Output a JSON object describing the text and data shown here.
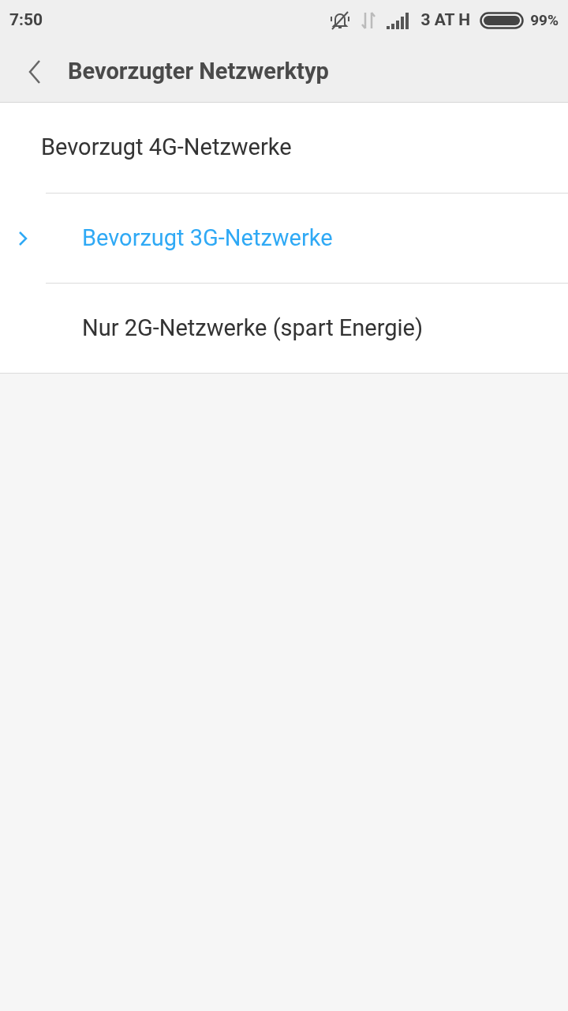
{
  "status_bar": {
    "time": "7:50",
    "carrier": "3 AT H",
    "battery": "99%"
  },
  "header": {
    "title": "Bevorzugter Netzwerktyp"
  },
  "options": [
    {
      "label": "Bevorzugt 4G-Netzwerke",
      "selected": false
    },
    {
      "label": "Bevorzugt 3G-Netzwerke",
      "selected": true
    },
    {
      "label": "Nur 2G-Netzwerke (spart Energie)",
      "selected": false
    }
  ]
}
